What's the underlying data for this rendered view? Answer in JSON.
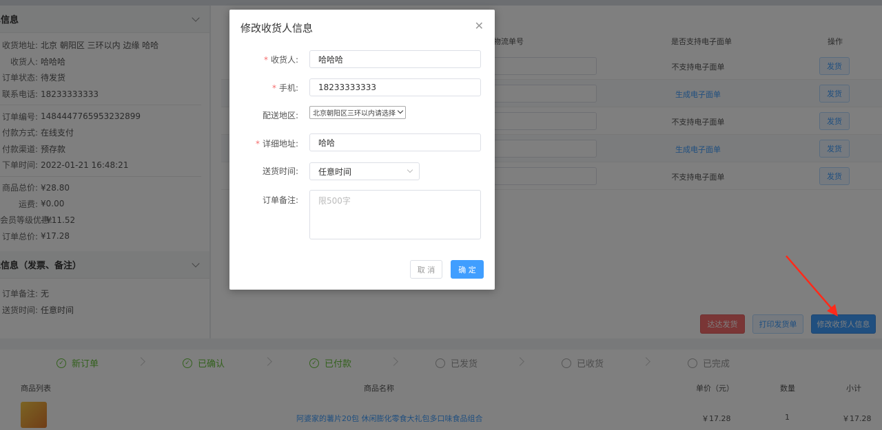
{
  "left_panel": {
    "order_section_title": "单信息",
    "address_row": {
      "key": "收货地址:",
      "value": "北京 朝阳区 三环以内 边缘 哈哈"
    },
    "receiver_row": {
      "key": "收货人:",
      "value": "哈哈哈"
    },
    "status_row": {
      "key": "订单状态:",
      "value": "待发货"
    },
    "phone_row": {
      "key": "联系电话:",
      "value": "18233333333"
    },
    "order_no_row": {
      "key": "订单编号:",
      "value": "1484447765953232899"
    },
    "pay_method_row": {
      "key": "付款方式:",
      "value": "在线支付"
    },
    "pay_channel_row": {
      "key": "付款渠道:",
      "value": "预存款"
    },
    "order_time_row": {
      "key": "下单时间:",
      "value": "2022-01-21 16:48:21"
    },
    "goods_total_row": {
      "key": "商品总价:",
      "value": "¥28.80"
    },
    "freight_row": {
      "key": "运费:",
      "value": "¥0.00"
    },
    "member_discount_row": {
      "key": "会员等级优惠:",
      "value": "- ¥11.52"
    },
    "order_total_row": {
      "key": "订单总价:",
      "value": "¥17.28"
    },
    "other_section_title": "他信息（发票、备注）",
    "remark_row": {
      "key": "订单备注:",
      "value": "无"
    },
    "delivery_time_row": {
      "key": "送货时间:",
      "value": "任意时间"
    }
  },
  "logistics_table": {
    "headers": {
      "tracking_no": "物流单号",
      "e_waybill": "是否支持电子面单",
      "action": "操作"
    },
    "rows": [
      {
        "e_waybill": "不支持电子面单",
        "action": "发货"
      },
      {
        "e_waybill": "生成电子面单",
        "action": "发货"
      },
      {
        "e_waybill": "不支持电子面单",
        "action": "发货"
      },
      {
        "e_waybill": "生成电子面单",
        "action": "发货"
      },
      {
        "e_waybill": "不支持电子面单",
        "action": "发货"
      }
    ]
  },
  "actions": {
    "dada": "达达发货",
    "print": "打印发货单",
    "edit_receiver": "修改收货人信息"
  },
  "steps": [
    {
      "label": "新订单",
      "done": true
    },
    {
      "label": "已确认",
      "done": true
    },
    {
      "label": "已付款",
      "done": true
    },
    {
      "label": "已发货",
      "done": false
    },
    {
      "label": "已收货",
      "done": false
    },
    {
      "label": "已完成",
      "done": false
    }
  ],
  "products": {
    "headers": {
      "list": "商品列表",
      "name": "商品名称",
      "price": "单价（元）",
      "qty": "数量",
      "subtotal": "小计"
    },
    "row": {
      "name": "阿婆家的薯片20包 休闲膨化零食大礼包多口味食品组合",
      "price": "￥17.28",
      "qty": "1",
      "subtotal": "￥17.28"
    }
  },
  "dialog": {
    "title": "修改收货人信息",
    "receiver_label": "收货人:",
    "receiver_value": "哈哈哈",
    "phone_label": "手机:",
    "phone_value": "18233333333",
    "region_label": "配送地区:",
    "region_value": "北京朝阳区三环以内请选择",
    "address_label": "详细地址:",
    "address_value": "哈哈",
    "time_label": "送货时间:",
    "time_value": "任意时间",
    "remark_label": "订单备注:",
    "remark_placeholder": "限500字",
    "cancel": "取 消",
    "ok": "确 定",
    "required_mark": "*"
  },
  "colors": {
    "primary": "#409eff",
    "danger": "#f56c6c",
    "success": "#67c23a",
    "arrow": "#ff2a1a"
  }
}
